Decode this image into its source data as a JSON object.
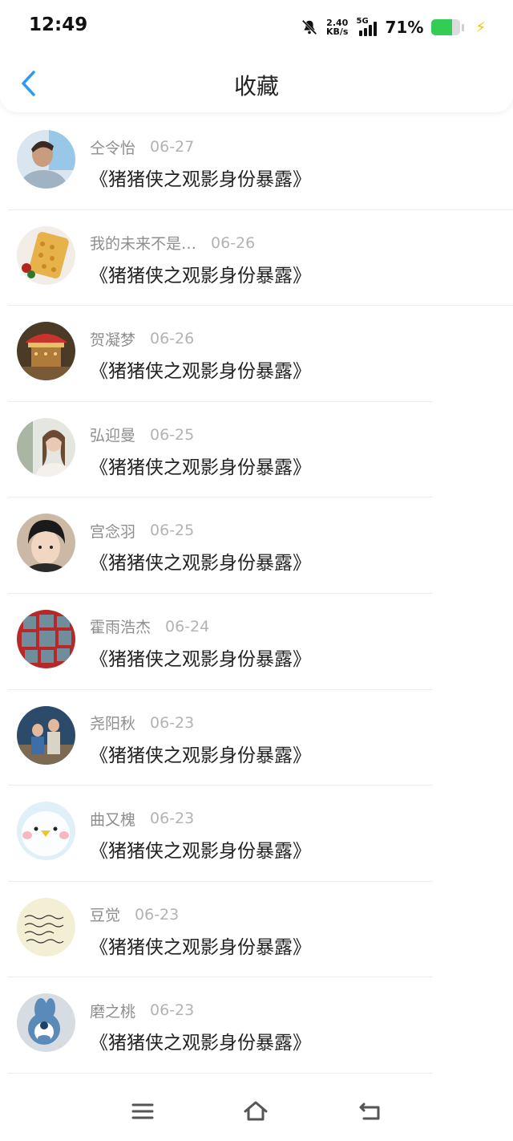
{
  "status": {
    "time": "12:49",
    "speed_value": "2.40",
    "speed_unit": "KB/s",
    "network": "5G",
    "battery_pct": "71%",
    "battery_color": "#33cc55"
  },
  "header": {
    "title": "收藏",
    "accent": "#2d9bf0"
  },
  "items": [
    {
      "user": "仝令怡",
      "date": "06-27",
      "title": "《猪猪侠之观影身份暴露》"
    },
    {
      "user": "我的未来不是…",
      "date": "06-26",
      "title": "《猪猪侠之观影身份暴露》"
    },
    {
      "user": "贺凝梦",
      "date": "06-26",
      "title": "《猪猪侠之观影身份暴露》"
    },
    {
      "user": "弘迎曼",
      "date": "06-25",
      "title": "《猪猪侠之观影身份暴露》"
    },
    {
      "user": "宫念羽",
      "date": "06-25",
      "title": "《猪猪侠之观影身份暴露》"
    },
    {
      "user": "霍雨浩杰",
      "date": "06-24",
      "title": "《猪猪侠之观影身份暴露》"
    },
    {
      "user": "尧阳秋",
      "date": "06-23",
      "title": "《猪猪侠之观影身份暴露》"
    },
    {
      "user": "曲又槐",
      "date": "06-23",
      "title": "《猪猪侠之观影身份暴露》"
    },
    {
      "user": "豆觉",
      "date": "06-23",
      "title": "《猪猪侠之观影身份暴露》"
    },
    {
      "user": "磨之桃",
      "date": "06-23",
      "title": "《猪猪侠之观影身份暴露》"
    }
  ],
  "icons": {
    "back": "chevron-left-icon",
    "menu": "menu-icon",
    "home": "home-icon",
    "system_back": "return-icon"
  }
}
